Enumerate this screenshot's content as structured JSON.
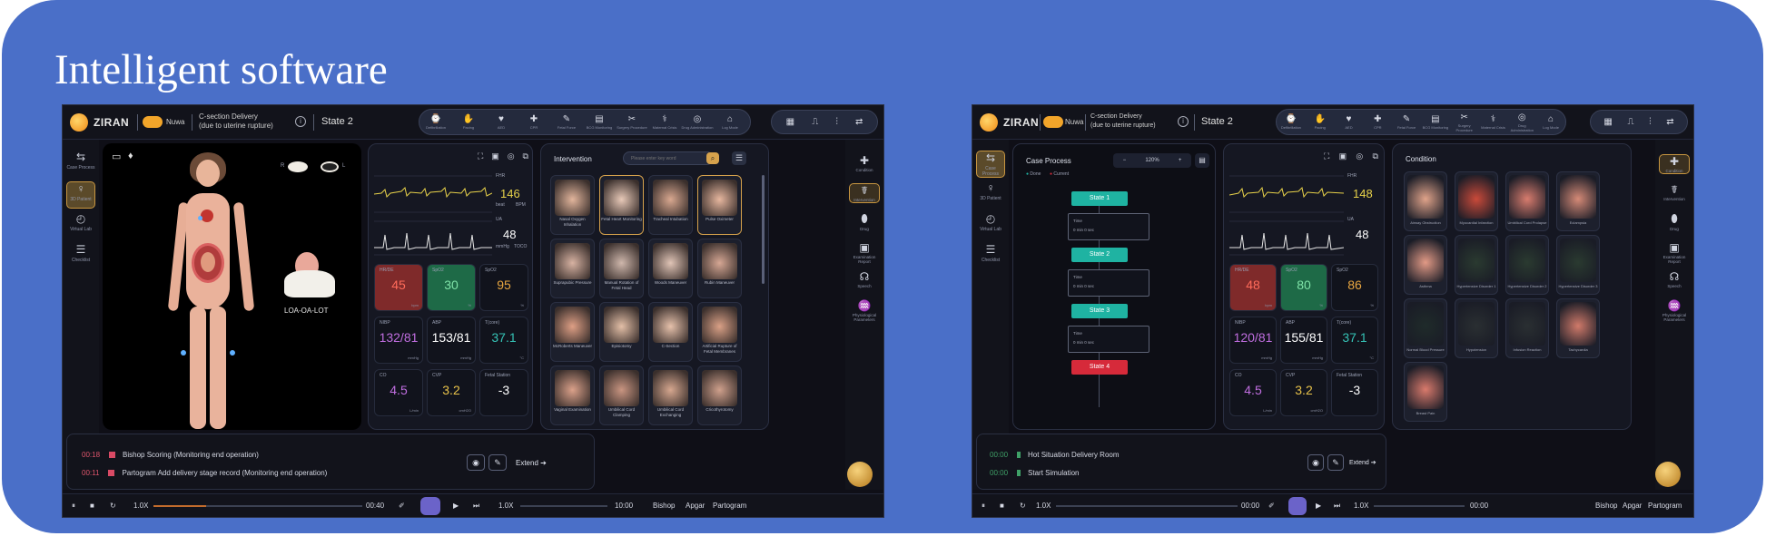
{
  "slide": {
    "title": "Intelligent software"
  },
  "app": {
    "brand": "ZIRAN",
    "patient": "Nuwa",
    "case_line1": "C-section Delivery",
    "case_line2": "(due to uterine rupture)",
    "state": "State 2",
    "info_icon": "i"
  },
  "toolbar": [
    {
      "icon": "⌚",
      "label": "Defibrillation"
    },
    {
      "icon": "✋",
      "label": "Pacing"
    },
    {
      "icon": "♥",
      "label": "AED"
    },
    {
      "icon": "✚",
      "label": "CPR"
    },
    {
      "icon": "✎",
      "label": "Fetal Force"
    },
    {
      "icon": "▤",
      "label": "BCG Monitoring"
    },
    {
      "icon": "✂",
      "label": "Surgery Procedure"
    },
    {
      "icon": "⚕",
      "label": "Maternal Crisis"
    },
    {
      "icon": "◎",
      "label": "Drug Administration"
    },
    {
      "icon": "⌂",
      "label": "Log Mode"
    }
  ],
  "right_pill": [
    "▦",
    "⎍",
    "⫶",
    "⇄"
  ],
  "left_nav": [
    {
      "icon": "⇆",
      "label": "Case Process"
    },
    {
      "icon": "♀",
      "label": "3D Patient"
    },
    {
      "icon": "◴",
      "label": "Virtual Lab"
    },
    {
      "icon": "☰",
      "label": "Checklist"
    }
  ],
  "viewer": {
    "orientation_r": "R",
    "orientation_l": "L",
    "fetal_position": "LOA-OA-LOT"
  },
  "monitor": {
    "labels": {
      "fhr": "FHR",
      "beat": "beat",
      "bpm": "BPM",
      "ua": "UA",
      "mmhg": "mmHg",
      "toco": "TOCO"
    },
    "fhr_value": "146",
    "ua_value": "48",
    "tiles": [
      {
        "label": "HR/DE",
        "value": "45",
        "unit": "bpm"
      },
      {
        "label": "SpO2",
        "value": "30",
        "unit": "%"
      },
      {
        "label": "SpO2",
        "value": "95",
        "unit": "%"
      },
      {
        "label": "NIBP",
        "value": "132/81",
        "unit": "mmHg"
      },
      {
        "label": "ABP",
        "value": "153/81",
        "unit": "mmHg"
      },
      {
        "label": "T(core)",
        "value": "37.1",
        "unit": "°C"
      },
      {
        "label": "CO",
        "value": "4.5",
        "unit": "L/min"
      },
      {
        "label": "CVP",
        "value": "3.2",
        "unit": "cmH2O"
      },
      {
        "label": "Fetal Station",
        "value": "-3",
        "unit": ""
      }
    ]
  },
  "intervention": {
    "title": "Intervention",
    "search_placeholder": "Please enter key word",
    "cards": [
      {
        "label": "Nasal Oxygen Inhalation"
      },
      {
        "label": "Fetal Heart Monitoring"
      },
      {
        "label": "Tracheal Intubation"
      },
      {
        "label": "Pulse Oximeter"
      },
      {
        "label": "Suprapubic Pressure"
      },
      {
        "label": "Manual Rotation of Fetal Head"
      },
      {
        "label": "Woods Maneuver"
      },
      {
        "label": "Rubin Maneuver"
      },
      {
        "label": "McRoberts Maneuver"
      },
      {
        "label": "Episiotomy"
      },
      {
        "label": "C-Section"
      },
      {
        "label": "Artificial Rupture of Fetal Membranes"
      },
      {
        "label": "Vaginal Examination"
      },
      {
        "label": "Umbilical Cord Clamping"
      },
      {
        "label": "Umbilical Cord Exchanging"
      },
      {
        "label": "Cricothyrotomy"
      }
    ]
  },
  "right_nav": [
    {
      "icon": "✚",
      "label": "Condition"
    },
    {
      "icon": "☤",
      "label": "Intervention"
    },
    {
      "icon": "⬮",
      "label": "Drug"
    },
    {
      "icon": "▣",
      "label": "Examination Report"
    },
    {
      "icon": "☊",
      "label": "Speech"
    },
    {
      "icon": "♒",
      "label": "Physiological Parameters"
    }
  ],
  "logs": [
    {
      "time": "00:18",
      "text": "Bishop Scoring (Monitoring end operation)"
    },
    {
      "time": "00:11",
      "text": "Partogram Add delivery stage record (Monitoring end operation)"
    }
  ],
  "extend_label": "Extend",
  "bottom": {
    "speed1": "1.0X",
    "time1": "00:40",
    "speed2": "1.0X",
    "time2": "10:00",
    "buttons": [
      "Bishop",
      "Apgar",
      "Partogram"
    ],
    "progress1": 0.25,
    "progress2": 0.0
  },
  "second": {
    "case_process": {
      "title": "Case Process",
      "legend_done": "Done",
      "legend_current": "Current",
      "zoom": "120%",
      "states": [
        "State 1",
        "State 2",
        "State 3",
        "State 4"
      ],
      "time_label": "Time",
      "time_value": "0 min 0 sec"
    },
    "condition": {
      "title": "Condition",
      "cards": [
        {
          "label": "Airway Obstruction"
        },
        {
          "label": "Myocardial Infarction"
        },
        {
          "label": "Umbilical Cord Prolapse"
        },
        {
          "label": "Eclampsia"
        },
        {
          "label": "Asthma"
        },
        {
          "label": "Hypertensive Disorder 1"
        },
        {
          "label": "Hypertensive Disorder 2"
        },
        {
          "label": "Hypertensive Disorder 3"
        },
        {
          "label": "Normal Blood Pressure"
        },
        {
          "label": "Hypotension"
        },
        {
          "label": "Infusion Reaction"
        },
        {
          "label": "Tachycardia"
        },
        {
          "label": "Breast Pain"
        }
      ]
    },
    "logs": [
      {
        "time": "00:00",
        "text": "Hot Situation Delivery Room"
      },
      {
        "time": "00:00",
        "text": "Start Simulation"
      }
    ],
    "tiles": [
      {
        "label": "HR/DE",
        "value": "48",
        "unit": "bpm"
      },
      {
        "label": "SpO2",
        "value": "80",
        "unit": "%"
      },
      {
        "label": "SpO2",
        "value": "86",
        "unit": "%"
      },
      {
        "label": "NIBP",
        "value": "120/81",
        "unit": "mmHg"
      },
      {
        "label": "ABP",
        "value": "155/81",
        "unit": "mmHg"
      },
      {
        "label": "T(core)",
        "value": "37.1",
        "unit": "°C"
      },
      {
        "label": "CO",
        "value": "4.5",
        "unit": "L/min"
      },
      {
        "label": "CVP",
        "value": "3.2",
        "unit": "cmH2O"
      },
      {
        "label": "Fetal Station",
        "value": "-3",
        "unit": ""
      }
    ],
    "fhr_value": "148",
    "ua_value": "48",
    "time1": "00:00",
    "time2": "00:00"
  },
  "colors": {
    "slide_bg": "#4a6fc8",
    "screen_bg": "#0f0f17",
    "accent_orange": "#d6a24c",
    "fhr_yellow": "#e8d24a",
    "red_tile": "#7f2a2a",
    "green_tile": "#1e6a47",
    "state_teal": "#1fb3a2",
    "state_red": "#d62a3a"
  }
}
